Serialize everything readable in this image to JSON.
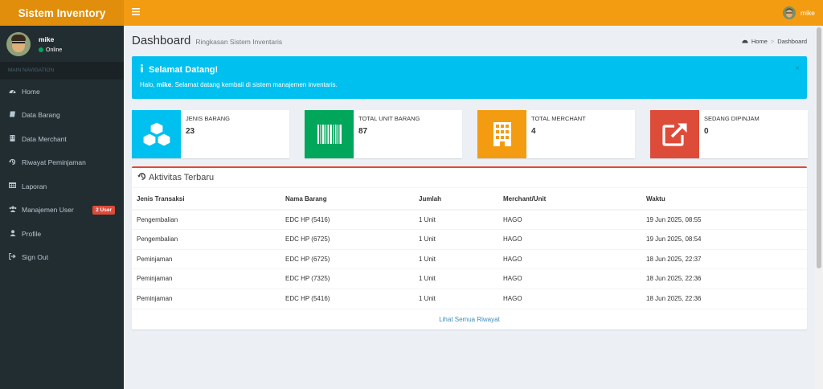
{
  "app": {
    "title": "Sistem Inventory"
  },
  "navbar": {
    "user_name": "mike",
    "toggle_icon": "hamburger-icon"
  },
  "sidebar": {
    "user": {
      "name": "mike",
      "status": "Online"
    },
    "nav_header": "MAIN NAVIGATION",
    "items": [
      {
        "label": "Home",
        "icon": "dashboard-icon"
      },
      {
        "label": "Data Barang",
        "icon": "book-icon"
      },
      {
        "label": "Data Merchant",
        "icon": "building-icon"
      },
      {
        "label": "Riwayat Peminjaman",
        "icon": "history-icon"
      },
      {
        "label": "Laporan",
        "icon": "table-icon"
      },
      {
        "label": "Manajemen User",
        "icon": "users-icon",
        "badge": "2 User"
      },
      {
        "label": "Profile",
        "icon": "user-icon"
      },
      {
        "label": "Sign Out",
        "icon": "sign-out-icon"
      }
    ]
  },
  "page": {
    "title": "Dashboard",
    "subtitle": "Ringkasan Sistem Inventaris"
  },
  "breadcrumb": {
    "home": "Home",
    "current": "Dashboard"
  },
  "alert": {
    "title": "Selamat Datang!",
    "text_prefix": "Halo, ",
    "user": "mike",
    "text_suffix": ". Selamat datang kembali di sistem manajemen inventaris.",
    "close": "×"
  },
  "info_boxes": [
    {
      "label": "JENIS BARANG",
      "value": "23",
      "color": "#00c0ef",
      "icon": "cubes-icon"
    },
    {
      "label": "TOTAL UNIT BARANG",
      "value": "87",
      "color": "#00a65a",
      "icon": "barcode-icon"
    },
    {
      "label": "TOTAL MERCHANT",
      "value": "4",
      "color": "#f39c12",
      "icon": "building-icon"
    },
    {
      "label": "SEDANG DIPINJAM",
      "value": "0",
      "color": "#dd4b39",
      "icon": "external-link-icon"
    }
  ],
  "activity": {
    "title": "Aktivitas Terbaru",
    "columns": [
      "Jenis Transaksi",
      "Nama Barang",
      "Jumlah",
      "Merchant/Unit",
      "Waktu"
    ],
    "rows": [
      [
        "Pengembalian",
        "EDC HP (5416)",
        "1 Unit",
        "HAGO",
        "19 Jun 2025, 08:55"
      ],
      [
        "Pengembalian",
        "EDC HP (6725)",
        "1 Unit",
        "HAGO",
        "19 Jun 2025, 08:54"
      ],
      [
        "Peminjaman",
        "EDC HP (6725)",
        "1 Unit",
        "HAGO",
        "18 Jun 2025, 22:37"
      ],
      [
        "Peminjaman",
        "EDC HP (7325)",
        "1 Unit",
        "HAGO",
        "18 Jun 2025, 22:36"
      ],
      [
        "Peminjaman",
        "EDC HP (5416)",
        "1 Unit",
        "HAGO",
        "18 Jun 2025, 22:36"
      ]
    ],
    "footer_link": "Lihat Semua Riwayat"
  }
}
